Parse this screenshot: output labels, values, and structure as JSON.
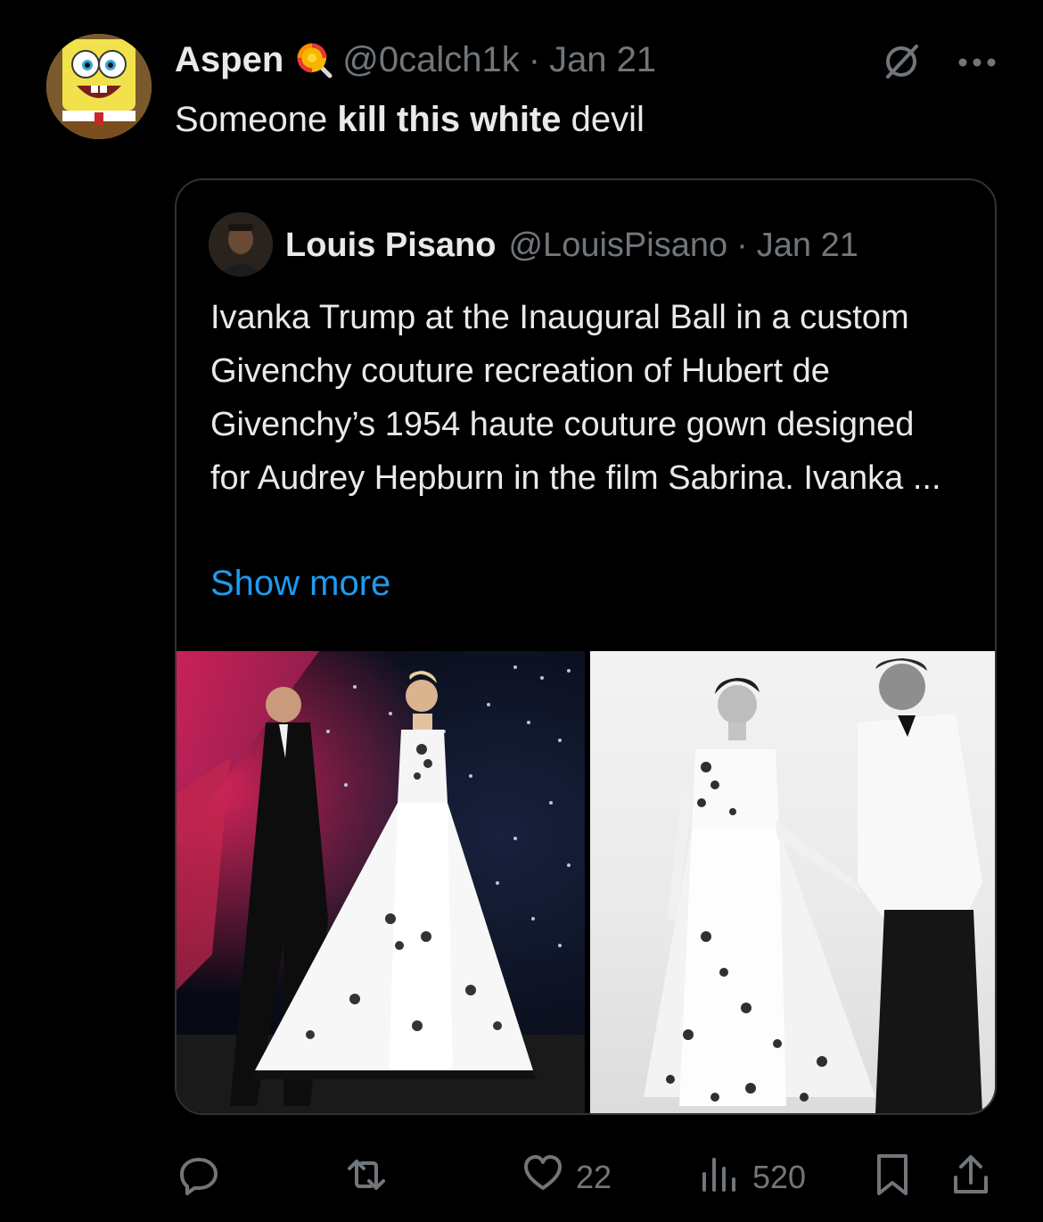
{
  "post": {
    "author_name": "Aspen",
    "author_handle": "@0calch1k",
    "separator": "·",
    "date": "Jan 21",
    "text_parts": {
      "before": "Someone ",
      "bold": "kill this white",
      "after": " devil"
    }
  },
  "quoted_post": {
    "author_name": "Louis Pisano",
    "author_handle": "@LouisPisano",
    "separator": "·",
    "date": "Jan 21",
    "text": "Ivanka Trump at the Inaugural Ball in a custom Givenchy couture recreation of Hubert de Givenchy’s 1954 haute couture gown designed for Audrey Hepburn in the film Sabrina. Ivanka ...",
    "show_more_label": "Show more"
  },
  "actions": {
    "reply_count": "",
    "repost_count": "",
    "like_count": "22",
    "views_count": "520"
  },
  "colors": {
    "background": "#000000",
    "text": "#e7e9ea",
    "muted": "#71767b",
    "link": "#1d9bf0",
    "border": "#2f3336"
  },
  "icons": [
    "grok-slash-circle-icon",
    "more-icon",
    "reply-icon",
    "repost-icon",
    "like-icon",
    "views-icon",
    "bookmark-icon",
    "share-icon",
    "lollipop-emoji-icon"
  ]
}
